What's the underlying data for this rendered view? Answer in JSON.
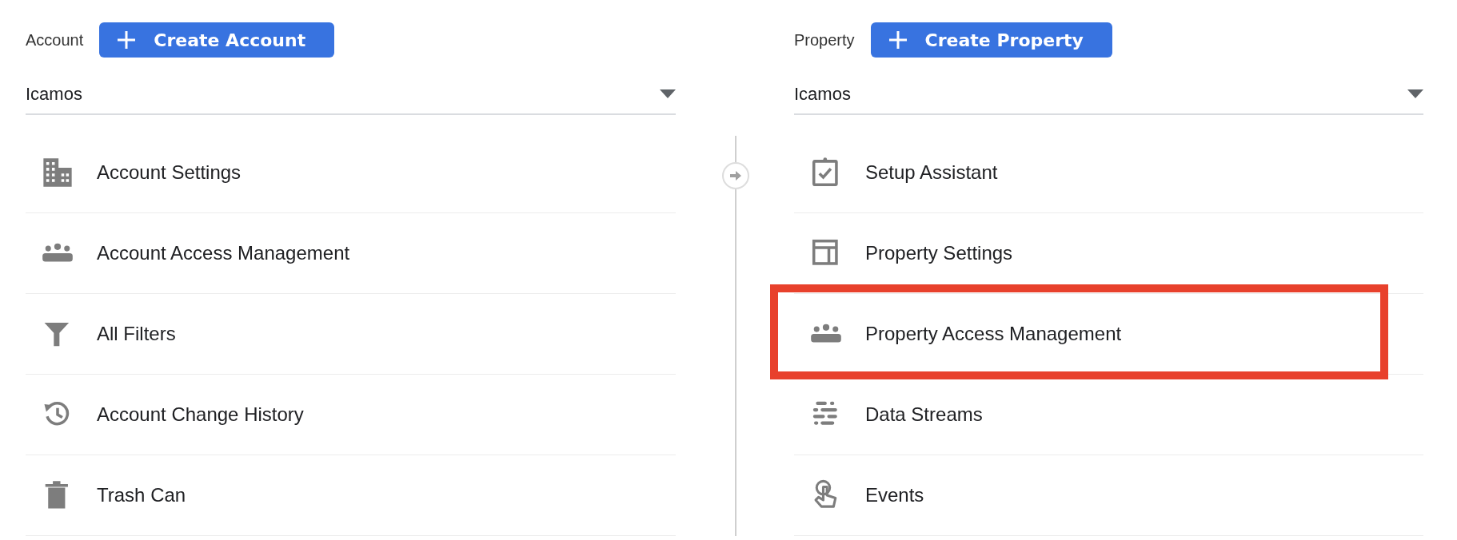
{
  "account": {
    "label": "Account",
    "button": "Create Account",
    "dropdown": "Icamos",
    "items": [
      {
        "label": "Account Settings",
        "highlighted": false
      },
      {
        "label": "Account Access Management",
        "highlighted": false
      },
      {
        "label": "All Filters",
        "highlighted": false
      },
      {
        "label": "Account Change History",
        "highlighted": false
      },
      {
        "label": "Trash Can",
        "highlighted": false
      }
    ]
  },
  "property": {
    "label": "Property",
    "button": "Create Property",
    "dropdown": "Icamos",
    "items": [
      {
        "label": "Setup Assistant",
        "highlighted": false
      },
      {
        "label": "Property Settings",
        "highlighted": false
      },
      {
        "label": "Property Access Management",
        "highlighted": true
      },
      {
        "label": "Data Streams",
        "highlighted": false
      },
      {
        "label": "Events",
        "highlighted": false
      }
    ]
  }
}
